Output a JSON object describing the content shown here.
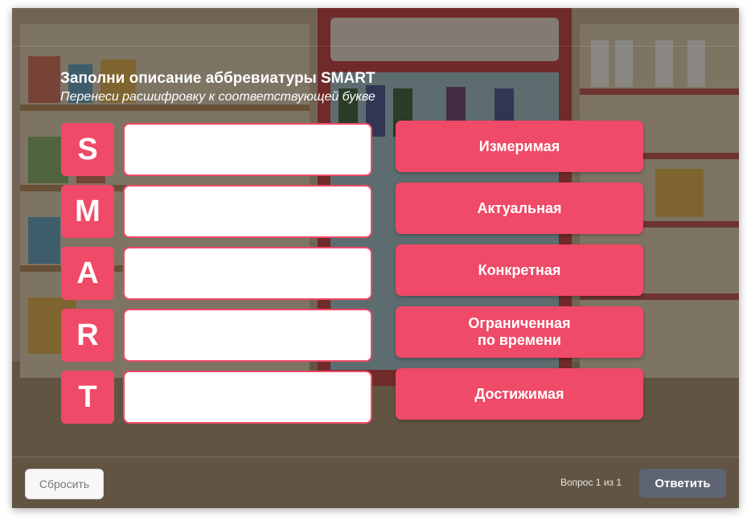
{
  "quiz": {
    "title": "Заполни описание аббревиатуры SMART",
    "instruction": "Перенеси расшифровку к соответствующей букве",
    "letters": [
      "S",
      "M",
      "A",
      "R",
      "T"
    ],
    "answer_cards": [
      "Измеримая",
      "Актуальная",
      "Конкретная",
      "Ограниченная\nпо времени",
      "Достижимая"
    ]
  },
  "footer": {
    "reset_label": "Сбросить",
    "question_counter": "Вопрос 1 из 1",
    "submit_label": "Ответить"
  },
  "colors": {
    "accent": "#ef4a67",
    "submit_button": "#5f6472"
  }
}
